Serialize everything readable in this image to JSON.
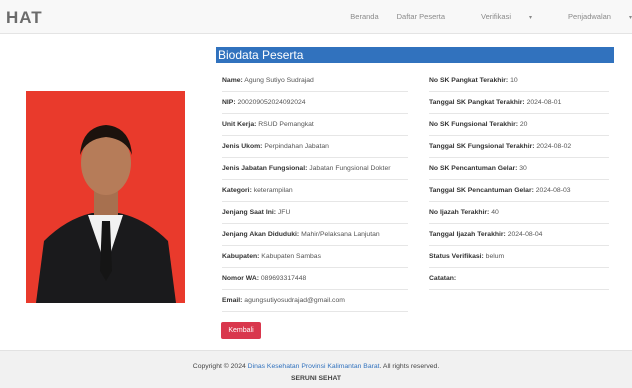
{
  "nav": {
    "brand": "HAT",
    "items": [
      {
        "label": "Beranda"
      },
      {
        "label": "Daftar Peserta"
      },
      {
        "label": "Verifikasi"
      },
      {
        "label": "Penjadwalan"
      }
    ]
  },
  "heading": "Biodata Peserta",
  "left_fields": [
    {
      "label": "Name:",
      "value": "Agung Sutiyo Sudrajad"
    },
    {
      "label": "NIP:",
      "value": "200209052024092024"
    },
    {
      "label": "Unit Kerja:",
      "value": "RSUD Pemangkat"
    },
    {
      "label": "Jenis Ukom:",
      "value": "Perpindahan Jabatan"
    },
    {
      "label": "Jenis Jabatan Fungsional:",
      "value": "Jabatan Fungsional Dokter"
    },
    {
      "label": "Kategori:",
      "value": "keterampilan"
    },
    {
      "label": "Jenjang Saat Ini:",
      "value": "JFU"
    },
    {
      "label": "Jenjang Akan Diduduki:",
      "value": "Mahir/Pelaksana Lanjutan"
    },
    {
      "label": "Kabupaten:",
      "value": "Kabupaten Sambas"
    },
    {
      "label": "Nomor WA:",
      "value": "089693317448"
    },
    {
      "label": "Email:",
      "value": "agungsutiyosudrajad@gmail.com"
    }
  ],
  "right_fields": [
    {
      "label": "No SK Pangkat Terakhir:",
      "value": "10"
    },
    {
      "label": "Tanggal SK Pangkat Terakhir:",
      "value": "2024-08-01"
    },
    {
      "label": "No SK Fungsional Terakhir:",
      "value": "20"
    },
    {
      "label": "Tanggal SK Fungsional Terakhir:",
      "value": "2024-08-02"
    },
    {
      "label": "No SK Pencantuman Gelar:",
      "value": "30"
    },
    {
      "label": "Tanggal SK Pencantuman Gelar:",
      "value": "2024-08-03"
    },
    {
      "label": "No Ijazah Terakhir:",
      "value": "40"
    },
    {
      "label": "Tanggal Ijazah Terakhir:",
      "value": "2024-08-04"
    },
    {
      "label": "Status Verifikasi:",
      "value": "belum"
    },
    {
      "label": "Catatan:",
      "value": ""
    }
  ],
  "back_button": "Kembali",
  "footer": {
    "prefix": "Copyright © 2024",
    "org": "Dinas Kesehatan Provinsi Kalimantan Barat",
    "suffix": ". All rights reserved.",
    "app": "SERUNI SEHAT"
  },
  "colors": {
    "accent": "#3172be",
    "button": "#d9374d",
    "photo_bg": "#e93a2c"
  }
}
